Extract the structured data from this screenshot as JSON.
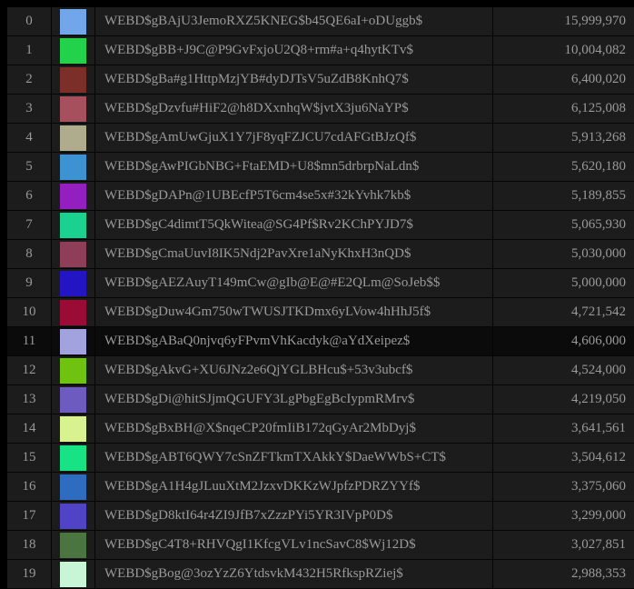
{
  "rows": [
    {
      "index": "0",
      "color": "#72a6ea",
      "name": "WEBD$gBAjU3JemoRXZ5KNEG$b45QE6aI+oDUggb$",
      "value": "15,999,970"
    },
    {
      "index": "1",
      "color": "#22d24b",
      "name": "WEBD$gBB+J9C@P9GvFxjoU2Q8+rm#a+q4hytKTv$",
      "value": "10,004,082"
    },
    {
      "index": "2",
      "color": "#7b2f28",
      "name": "WEBD$gBa#g1HttpMzjYB#dyDJTsV5uZdB8KnhQ7$",
      "value": "6,400,020"
    },
    {
      "index": "3",
      "color": "#a5505c",
      "name": "WEBD$gDzvfu#HiF2@h8DXxnhqW$jvtX3ju6NaYP$",
      "value": "6,125,008"
    },
    {
      "index": "4",
      "color": "#aeac8c",
      "name": "WEBD$gAmUwGjuX1Y7jF8yqFZJCU7cdAFGtBJzQf$",
      "value": "5,913,268"
    },
    {
      "index": "5",
      "color": "#3d93d2",
      "name": "WEBD$gAwPIGbNBG+FtaEMD+U8$mn5drbrpNaLdn$",
      "value": "5,620,180"
    },
    {
      "index": "6",
      "color": "#931fc1",
      "name": "WEBD$gDAPn@1UBEcfP5T6cm4se5x#32kYvhk7kb$",
      "value": "5,189,855"
    },
    {
      "index": "7",
      "color": "#1ad190",
      "name": "WEBD$gC4dimtT5QkWitea@SG4Pf$Rv2KChPYJD7$",
      "value": "5,065,930"
    },
    {
      "index": "8",
      "color": "#8f3e5a",
      "name": "WEBD$gCmaUuvI8IK5Ndj2PavXre1aNyKhxH3nQD$",
      "value": "5,030,000"
    },
    {
      "index": "9",
      "color": "#2314c4",
      "name": "WEBD$gAEZAuyT149mCw@gIb@E@#E2QLm@SoJeb$$",
      "value": "5,000,000"
    },
    {
      "index": "10",
      "color": "#9a0b36",
      "name": "WEBD$gDuw4Gm750wTWUSJTKDmx6yLVow4hHhJ5f$",
      "value": "4,721,542"
    },
    {
      "index": "11",
      "color": "#a2a2de",
      "name": "WEBD$gABaQ0njvq6yFPvmVhKacdyk@aYdXeipez$",
      "value": "4,606,000"
    },
    {
      "index": "12",
      "color": "#6fc20f",
      "name": "WEBD$gAkvG+XU6JNz2e6QjYGLBHcu$+53v3ubcf$",
      "value": "4,524,000"
    },
    {
      "index": "13",
      "color": "#6e5bc0",
      "name": "WEBD$gDi@hitSJjmQGUFY3LgPbgEgBcIypmRMrv$",
      "value": "4,219,050"
    },
    {
      "index": "14",
      "color": "#d7f28e",
      "name": "WEBD$gBxBH@X$nqeCP20fmIiB172qGyAr2MbDyj$",
      "value": "3,641,561"
    },
    {
      "index": "15",
      "color": "#17e384",
      "name": "WEBD$gABT6QWY7cSnZFTkmTXAkkY$DaeWWbS+CT$",
      "value": "3,504,612"
    },
    {
      "index": "16",
      "color": "#2e6cbf",
      "name": "WEBD$gA1H4gJLuuXtM2JzxvDKKzWJpfzPDRZYYf$",
      "value": "3,375,060"
    },
    {
      "index": "17",
      "color": "#5143c5",
      "name": "WEBD$gD8ktI64r4ZI9JfB7xZzzPYi5YR3IVpP0D$",
      "value": "3,299,000"
    },
    {
      "index": "18",
      "color": "#4a7440",
      "name": "WEBD$gC4T8+RHVQgI1KfcgVLv1ncSavC8$Wj12D$",
      "value": "3,027,851"
    },
    {
      "index": "19",
      "color": "#c8f5d6",
      "name": "WEBD$gBog@3ozYzZ6YtdsvkM432H5RfkspRZiej$",
      "value": "2,988,353"
    }
  ]
}
